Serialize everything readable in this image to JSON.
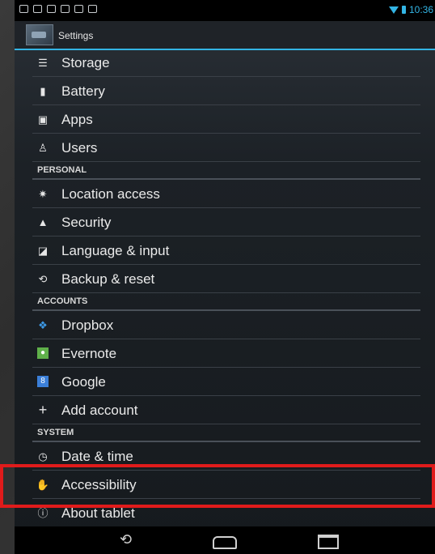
{
  "status": {
    "time": "10:36"
  },
  "actionbar": {
    "title": "Settings"
  },
  "items_top": [
    {
      "label": "Storage",
      "icon": "storage-icon"
    },
    {
      "label": "Battery",
      "icon": "battery-icon"
    },
    {
      "label": "Apps",
      "icon": "apps-icon"
    },
    {
      "label": "Users",
      "icon": "users-icon"
    }
  ],
  "personal": {
    "header": "PERSONAL",
    "items": [
      {
        "label": "Location access",
        "icon": "location-icon"
      },
      {
        "label": "Security",
        "icon": "lock-icon"
      },
      {
        "label": "Language & input",
        "icon": "language-icon"
      },
      {
        "label": "Backup & reset",
        "icon": "backup-icon"
      }
    ]
  },
  "accounts": {
    "header": "ACCOUNTS",
    "items": [
      {
        "label": "Dropbox",
        "icon": "dropbox-icon"
      },
      {
        "label": "Evernote",
        "icon": "evernote-icon"
      },
      {
        "label": "Google",
        "icon": "google-icon"
      },
      {
        "label": "Add account",
        "icon": "plus-icon"
      }
    ]
  },
  "system": {
    "header": "SYSTEM",
    "items": [
      {
        "label": "Date & time",
        "icon": "clock-icon"
      },
      {
        "label": "Accessibility",
        "icon": "hand-icon"
      },
      {
        "label": "About tablet",
        "icon": "info-icon"
      }
    ]
  },
  "colors": {
    "accent": "#33b5e5",
    "highlight": "#e01b1b"
  }
}
